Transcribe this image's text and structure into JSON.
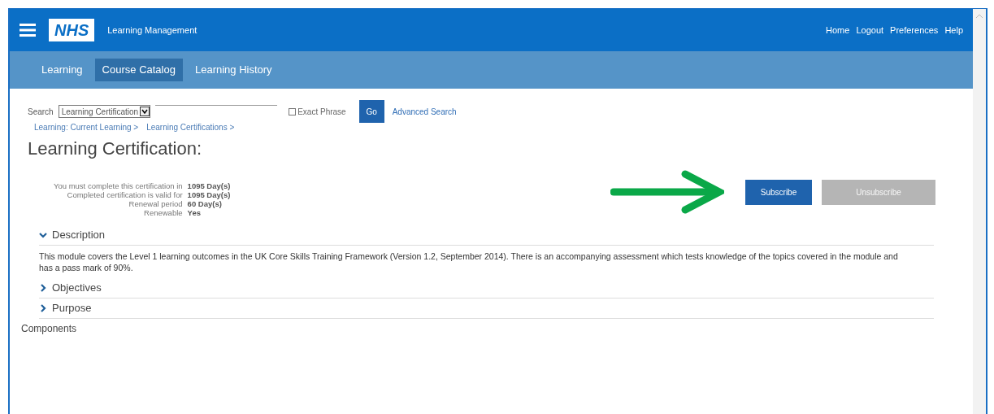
{
  "header": {
    "logo": "NHS",
    "title": "Learning Management",
    "links": [
      "Home",
      "Logout",
      "Preferences",
      "Help"
    ]
  },
  "tabs": [
    {
      "label": "Learning",
      "selected": false
    },
    {
      "label": "Course Catalog",
      "selected": true
    },
    {
      "label": "Learning History",
      "selected": false
    }
  ],
  "search": {
    "label": "Search",
    "scope": "Learning Certification",
    "exact_phrase": {
      "label": "Exact Phrase",
      "checked": false
    },
    "go": "Go",
    "advanced": "Advanced Search"
  },
  "breadcrumbs": [
    "Learning: Current Learning >",
    "Learning Certifications >"
  ],
  "page_title": "Learning Certification:",
  "actions": [
    {
      "label": "Subscribe",
      "disabled": false
    },
    {
      "label": "Unsubscribe",
      "disabled": true
    }
  ],
  "details": [
    {
      "label": "You must complete this certification in",
      "value": "1095  Day(s)"
    },
    {
      "label": "Completed certification is valid for",
      "value": "1095  Day(s)"
    },
    {
      "label": "Renewal period",
      "value": "60  Day(s)"
    },
    {
      "label": "Renewable",
      "value": "Yes"
    }
  ],
  "sections": [
    {
      "title": "Description",
      "expanded": true,
      "body": "This module covers the Level 1 learning outcomes in the UK Core Skills Training Framework (Version 1.2, September 2014). There is an accompanying assessment which tests knowledge of the topics covered in the module and has a pass mark of 90%."
    },
    {
      "title": "Objectives",
      "expanded": false
    },
    {
      "title": "Purpose",
      "expanded": false
    }
  ],
  "components_heading": "Components"
}
